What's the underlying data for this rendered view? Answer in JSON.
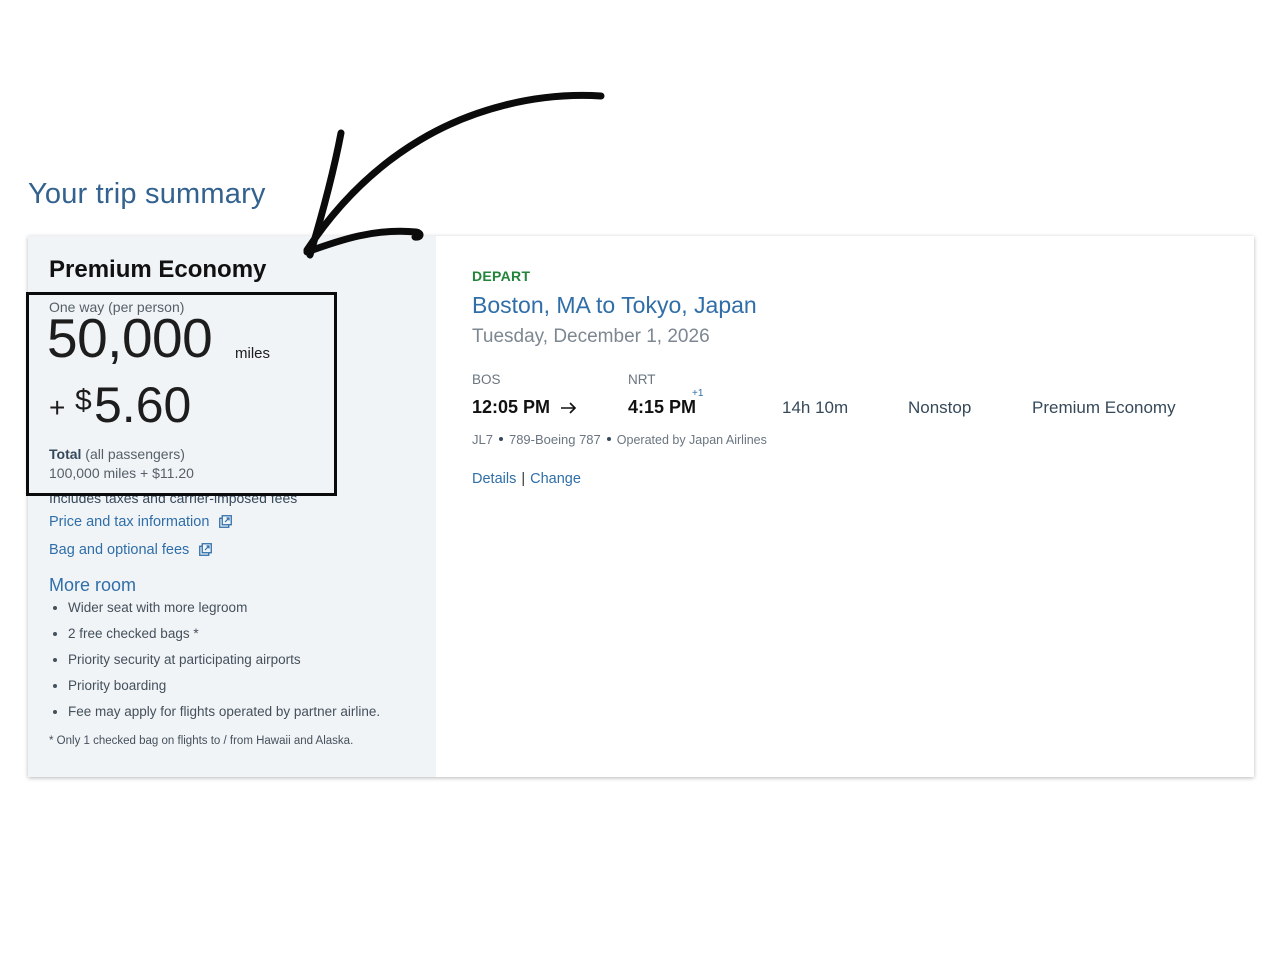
{
  "page": {
    "title": "Your trip summary"
  },
  "fare": {
    "cabin_title": "Premium Economy",
    "one_way_label": "One way (per person)",
    "miles": "50,000",
    "miles_unit": "miles",
    "plus": "+",
    "currency_symbol": "$",
    "cash": "5.60",
    "total_label": "Total",
    "total_qualifier": "(all passengers)",
    "total_amounts": "100,000 miles + $11.20",
    "fees_note": "Includes taxes and carrier-imposed fees",
    "price_tax_link": "Price and tax information",
    "bag_fees_link": "Bag and optional fees",
    "more_room_heading": "More room",
    "benefits": [
      "Wider seat with more legroom",
      "2 free checked bags *",
      "Priority security at participating airports",
      "Priority boarding",
      "Fee may apply for flights operated by partner airline."
    ],
    "footnote": "* Only 1 checked bag on flights to / from Hawaii and Alaska."
  },
  "trip": {
    "direction_label": "DEPART",
    "route": "Boston, MA to Tokyo, Japan",
    "date": "Tuesday, December 1, 2026",
    "origin_code": "BOS",
    "destination_code": "NRT",
    "depart_time": "12:05 PM",
    "arrive_time": "4:15 PM",
    "day_offset": "+1",
    "duration": "14h 10m",
    "stops": "Nonstop",
    "cabin": "Premium Economy",
    "flight_number": "JL7",
    "aircraft": "789-Boeing 787",
    "operator": "Operated by Japan Airlines",
    "details_link": "Details",
    "link_separator": "|",
    "change_link": "Change"
  },
  "colors": {
    "title_blue": "#33628f",
    "link_blue": "#2f6ea8",
    "depart_green": "#23853a",
    "panel_background": "#f1f4f7",
    "annotation_black": "#0b0b0b"
  },
  "icons": {
    "external_link": "external-link-icon",
    "arrow_right": "arrow-right-icon",
    "annotation_arrow": "hand-drawn-arrow-icon"
  }
}
